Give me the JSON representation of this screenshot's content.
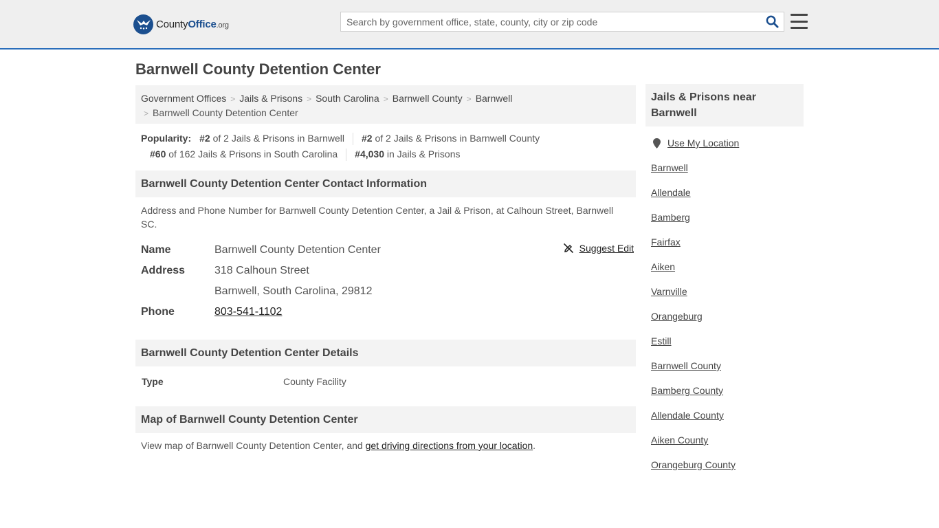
{
  "header": {
    "logo": {
      "brand_a": "County",
      "brand_b": "Office",
      "brand_c": ".org"
    },
    "search": {
      "placeholder": "Search by government office, state, county, city or zip code"
    }
  },
  "page": {
    "title": "Barnwell County Detention Center"
  },
  "breadcrumb": {
    "items": [
      "Government Offices",
      "Jails & Prisons",
      "South Carolina",
      "Barnwell County",
      "Barnwell"
    ],
    "current": "Barnwell County Detention Center"
  },
  "popularity": {
    "label": "Popularity:",
    "items": [
      {
        "rank": "#2",
        "text": " of 2 Jails & Prisons in Barnwell"
      },
      {
        "rank": "#2",
        "text": " of 2 Jails & Prisons in Barnwell County"
      },
      {
        "rank": "#60",
        "text": " of 162 Jails & Prisons in South Carolina"
      },
      {
        "rank": "#4,030",
        "text": " in Jails & Prisons"
      }
    ]
  },
  "contact": {
    "heading": "Barnwell County Detention Center Contact Information",
    "description": "Address and Phone Number for Barnwell County Detention Center, a Jail & Prison, at Calhoun Street, Barnwell SC.",
    "suggest_edit": "Suggest Edit",
    "name_label": "Name",
    "name_value": "Barnwell County Detention Center",
    "address_label": "Address",
    "address_line1": "318 Calhoun Street",
    "address_line2": "Barnwell, South Carolina, 29812",
    "phone_label": "Phone",
    "phone_value": "803-541-1102"
  },
  "details": {
    "heading": "Barnwell County Detention Center Details",
    "type_label": "Type",
    "type_value": "County Facility"
  },
  "map": {
    "heading": "Map of Barnwell County Detention Center",
    "desc_prefix": "View map of Barnwell County Detention Center, and ",
    "link": "get driving directions from your location",
    "desc_suffix": "."
  },
  "sidebar": {
    "heading": "Jails & Prisons near Barnwell",
    "use_location": "Use My Location",
    "items": [
      "Barnwell",
      "Allendale",
      "Bamberg",
      "Fairfax",
      "Aiken",
      "Varnville",
      "Orangeburg",
      "Estill",
      "Barnwell County",
      "Bamberg County",
      "Allendale County",
      "Aiken County",
      "Orangeburg County"
    ]
  },
  "colors": {
    "accent": "#2a6ebb",
    "brand": "#1b4f8f",
    "panel": "#f3f3f3",
    "header_bg": "#efefef"
  }
}
